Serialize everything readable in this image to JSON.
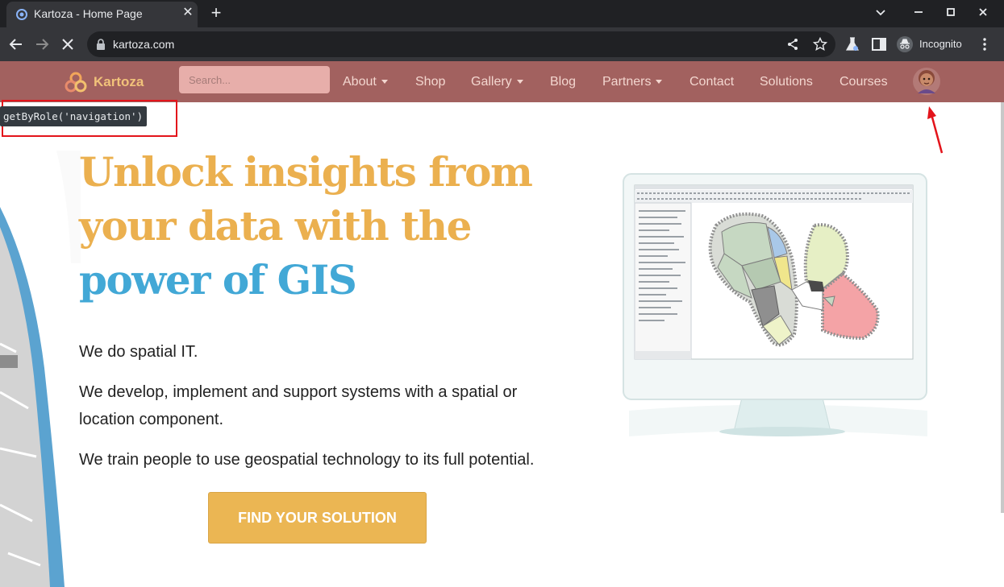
{
  "browser": {
    "tab_title": "Kartoza - Home Page",
    "new_tab_label": "+",
    "url": "kartoza.com",
    "incognito_label": "Incognito"
  },
  "nav": {
    "brand": "Kartoza",
    "search_placeholder": "Search...",
    "items": [
      {
        "label": "About",
        "dropdown": true
      },
      {
        "label": "Shop",
        "dropdown": false
      },
      {
        "label": "Gallery",
        "dropdown": true
      },
      {
        "label": "Blog",
        "dropdown": false
      },
      {
        "label": "Partners",
        "dropdown": true
      },
      {
        "label": "Contact",
        "dropdown": false
      },
      {
        "label": "Solutions",
        "dropdown": false
      },
      {
        "label": "Courses",
        "dropdown": false
      }
    ]
  },
  "overlay": {
    "locator_text": "getByRole('navigation')"
  },
  "hero": {
    "title_part1": "Unlock insights from your data with the ",
    "title_part2": "power of GIS",
    "p1": "We do spatial IT.",
    "p2": "We develop, implement and support systems with a spatial or location component.",
    "p3": "We train people to use geospatial technology to its full potential.",
    "cta_label": "FIND YOUR SOLUTION"
  },
  "colors": {
    "nav_bg": "#a2615f",
    "title_orange": "#ebb04f",
    "title_blue": "#42a8d6",
    "cta_bg": "#ebb653",
    "highlight_red": "#e3141b"
  }
}
